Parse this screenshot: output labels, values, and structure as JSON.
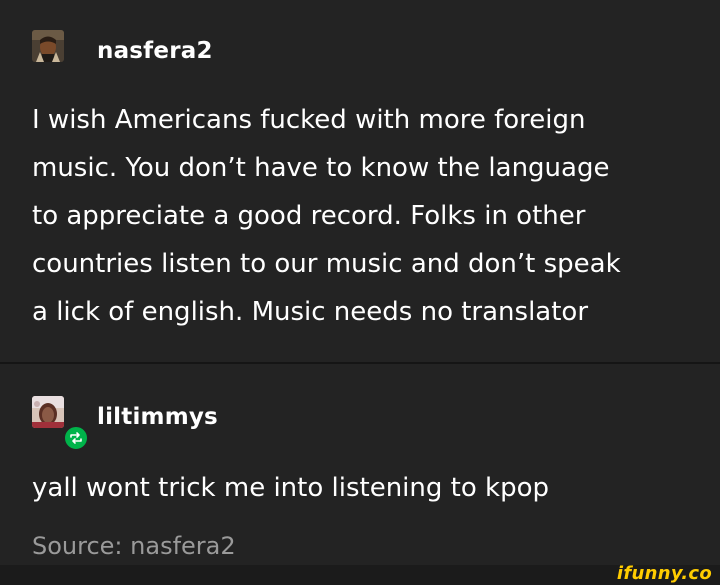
{
  "posts": [
    {
      "username": "nasfera2",
      "text_lines": [
        "I wish Americans fucked with more foreign",
        "music. You don’t have to know the language",
        "to appreciate a good record. Folks in other",
        "countries listen to our music and don’t speak",
        "a lick of english. Music needs no translator"
      ]
    },
    {
      "username": "liltimmys",
      "text": "yall wont trick me into listening to kpop",
      "source": "Source: nasfera2"
    }
  ],
  "icons": {
    "reblog": "reblog-icon",
    "reblog_color": "#00b34a"
  },
  "watermark": "ifunny.co",
  "colors": {
    "background": "#232323",
    "text": "#ffffff",
    "source": "#9a9a9a",
    "watermark": "#ffcc00"
  }
}
